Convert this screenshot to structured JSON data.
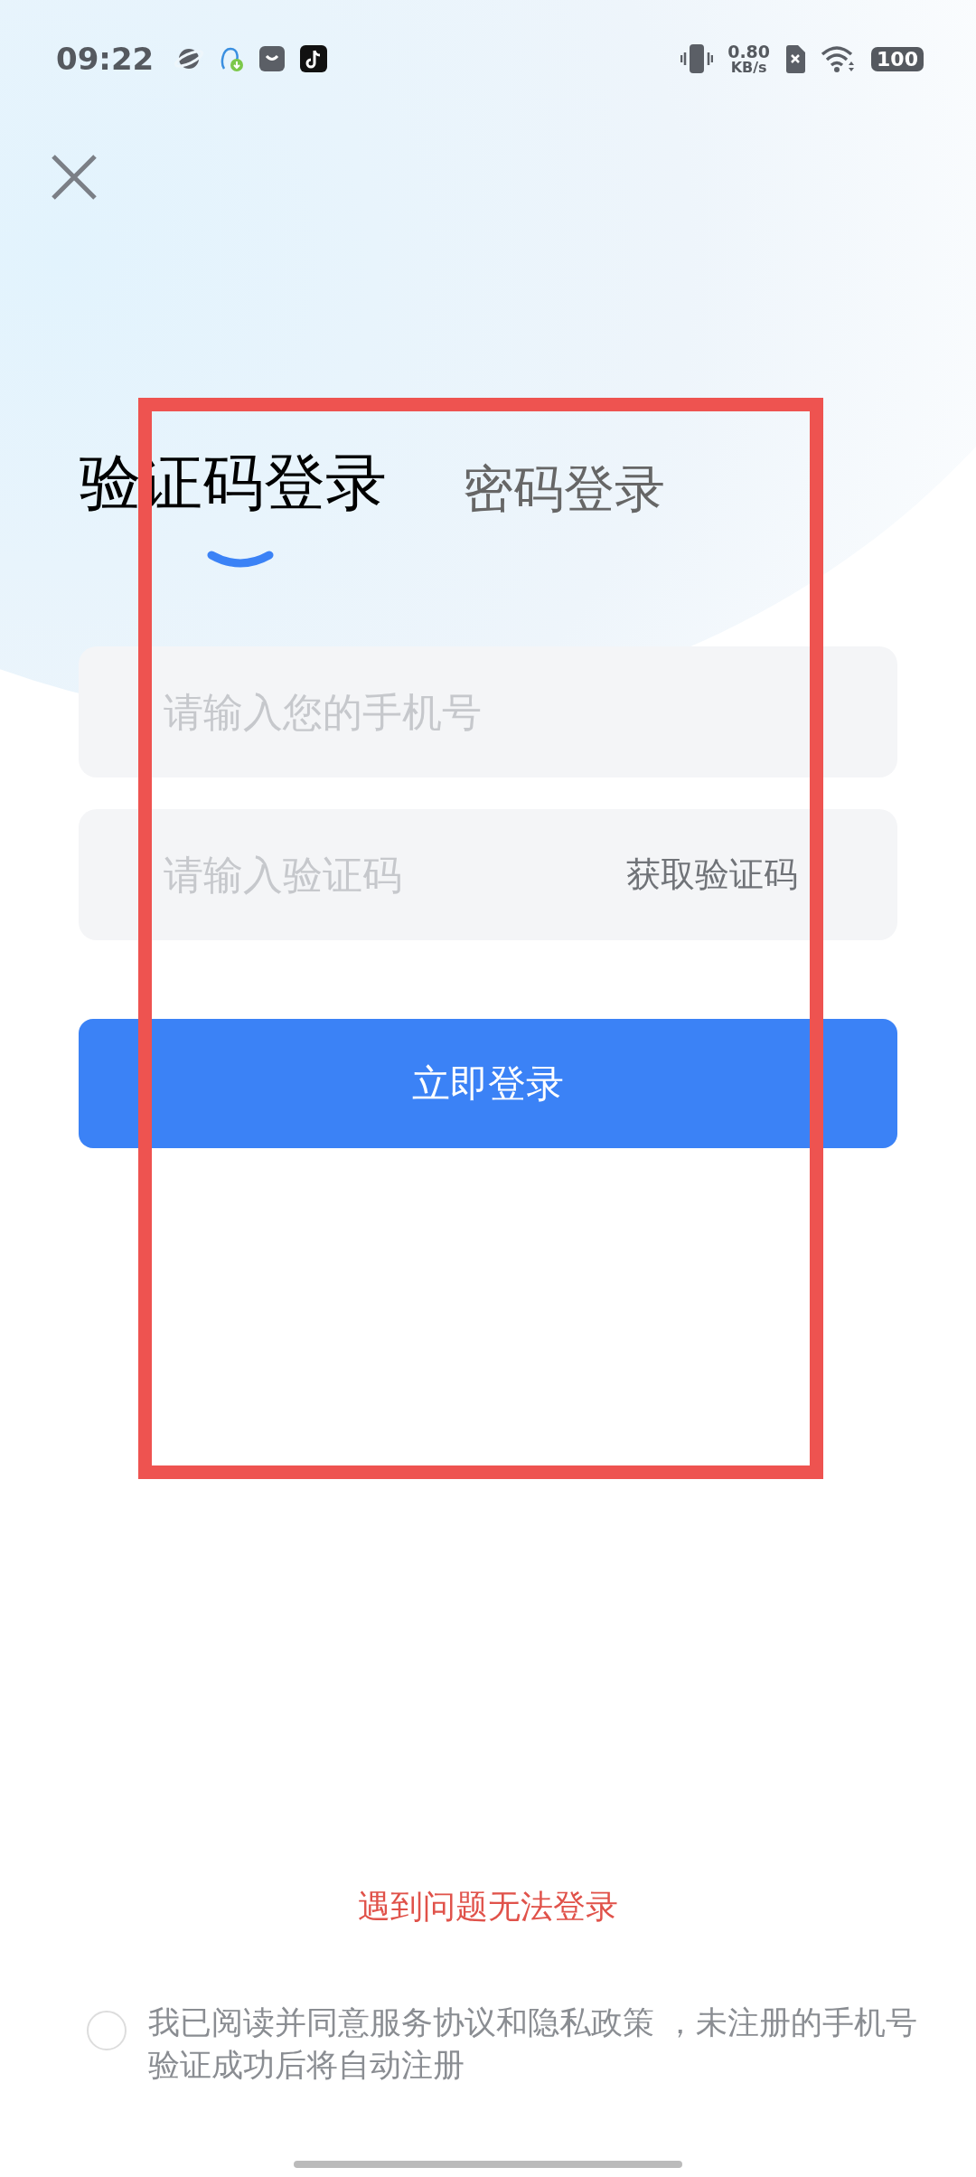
{
  "status_bar": {
    "time": "09:22",
    "net_speed_value": "0.80",
    "net_speed_unit": "KB/s",
    "battery": "100"
  },
  "tabs": [
    {
      "label": "验证码登录",
      "selected": true
    },
    {
      "label": "密码登录",
      "selected": false
    }
  ],
  "phone_field": {
    "placeholder": "请输入您的手机号"
  },
  "code_field": {
    "placeholder": "请输入验证码",
    "action": "获取验证码"
  },
  "login_button": "立即登录",
  "help_link": "遇到问题无法登录",
  "agreement": {
    "checked": false,
    "text": "我已阅读并同意服务协议和隐私政策 ，未注册的手机号验证成功后将自动注册"
  },
  "annotation_frame": {
    "color": "#ee5350"
  }
}
